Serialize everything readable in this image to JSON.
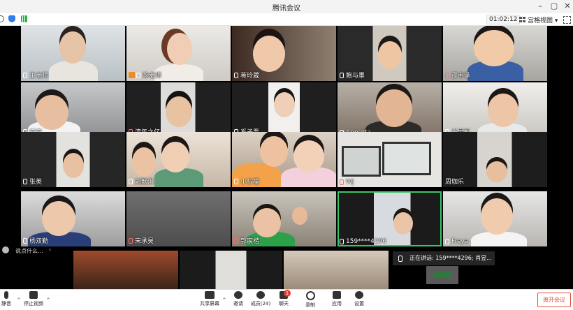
{
  "window": {
    "title": "腾讯会议",
    "controls": [
      "minimize-icon",
      "maximize-icon",
      "close-icon"
    ]
  },
  "topbar": {
    "timer": "01:02:12",
    "view_label": "宫格视图",
    "icons": [
      "info-icon",
      "shield-icon",
      "signal-icon",
      "fullscreen-icon"
    ]
  },
  "participants": [
    {
      "name": "王老师",
      "muted": false
    },
    {
      "name": "陈老师",
      "muted": false,
      "host": true
    },
    {
      "name": "蒋玲葳",
      "muted": false
    },
    {
      "name": "鲍与墨",
      "muted": false
    },
    {
      "name": "邵申泽",
      "muted": true
    },
    {
      "name": "安安",
      "muted": false
    },
    {
      "name": "流年之亿",
      "muted": true
    },
    {
      "name": "奚子晋",
      "muted": false
    },
    {
      "name": "Annetta",
      "muted": false
    },
    {
      "name": "肖昱枫",
      "muted": false
    },
    {
      "name": "张英",
      "muted": false
    },
    {
      "name": "刘歆淇",
      "muted": false
    },
    {
      "name": "小柠檬",
      "muted": false
    },
    {
      "name": "WJ",
      "muted": true
    },
    {
      "name": "周珈乐",
      "muted": false
    },
    {
      "name": "杨双勤",
      "muted": false
    },
    {
      "name": "宋承昊",
      "muted": true
    },
    {
      "name": "郭宸楷",
      "muted": true
    },
    {
      "name": "159****4296",
      "muted": false,
      "active": true
    },
    {
      "name": "Freya",
      "muted": false
    }
  ],
  "chat_preview": "说点什么...",
  "speaking": "正在讲话: 159****4296; 肖昱...",
  "toolbar": {
    "mute": "静音",
    "stop_video": "停止视频",
    "share_screen": "共享屏幕",
    "invite": "邀请",
    "members": "成员(24)",
    "chat": "聊天",
    "chat_badge": "1",
    "record": "录制",
    "apps": "应用",
    "settings": "设置",
    "leave": "离开会议"
  }
}
